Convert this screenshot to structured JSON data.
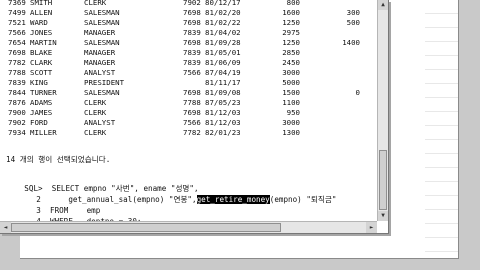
{
  "results": {
    "rows": [
      [
        "7369",
        "SMITH",
        "CLERK",
        "7902",
        "80/12/17",
        "800",
        ""
      ],
      [
        "7499",
        "ALLEN",
        "SALESMAN",
        "7698",
        "81/02/20",
        "1600",
        "300"
      ],
      [
        "7521",
        "WARD",
        "SALESMAN",
        "7698",
        "81/02/22",
        "1250",
        "500"
      ],
      [
        "7566",
        "JONES",
        "MANAGER",
        "7839",
        "81/04/02",
        "2975",
        ""
      ],
      [
        "7654",
        "MARTIN",
        "SALESMAN",
        "7698",
        "81/09/28",
        "1250",
        "1400"
      ],
      [
        "7698",
        "BLAKE",
        "MANAGER",
        "7839",
        "81/05/01",
        "2850",
        ""
      ],
      [
        "7782",
        "CLARK",
        "MANAGER",
        "7839",
        "81/06/09",
        "2450",
        ""
      ],
      [
        "7788",
        "SCOTT",
        "ANALYST",
        "7566",
        "87/04/19",
        "3000",
        ""
      ],
      [
        "7839",
        "KING",
        "PRESIDENT",
        "",
        "81/11/17",
        "5000",
        ""
      ],
      [
        "7844",
        "TURNER",
        "SALESMAN",
        "7698",
        "81/09/08",
        "1500",
        "0"
      ],
      [
        "7876",
        "ADAMS",
        "CLERK",
        "7788",
        "87/05/23",
        "1100",
        ""
      ],
      [
        "7900",
        "JAMES",
        "CLERK",
        "7698",
        "81/12/03",
        "950",
        ""
      ],
      [
        "7902",
        "FORD",
        "ANALYST",
        "7566",
        "81/12/03",
        "3000",
        ""
      ],
      [
        "7934",
        "MILLER",
        "CLERK",
        "7782",
        "82/01/23",
        "1300",
        ""
      ]
    ]
  },
  "message": "14 개의 행이 선택되었습니다.",
  "sql": {
    "line1_prefix": "SQL>",
    "line1": "SELECT empno \"사번\", ename \"성명\",",
    "line2_a": "get_annual_sal(empno) \"연봉\",",
    "line2_hl": "get_retire_money",
    "line2_b": "(empno) \"퇴직금\"",
    "line3_no": "3",
    "line3": "FROM    emp",
    "line4_no": "4",
    "line4": "WHERE   deptno = 30;",
    "line2_no": "2"
  },
  "background_window": {
    "row": "7900 JAMES          11400        15996"
  },
  "scroll_icons": {
    "up": "▲",
    "down": "▼",
    "left": "◄",
    "right": "►"
  }
}
